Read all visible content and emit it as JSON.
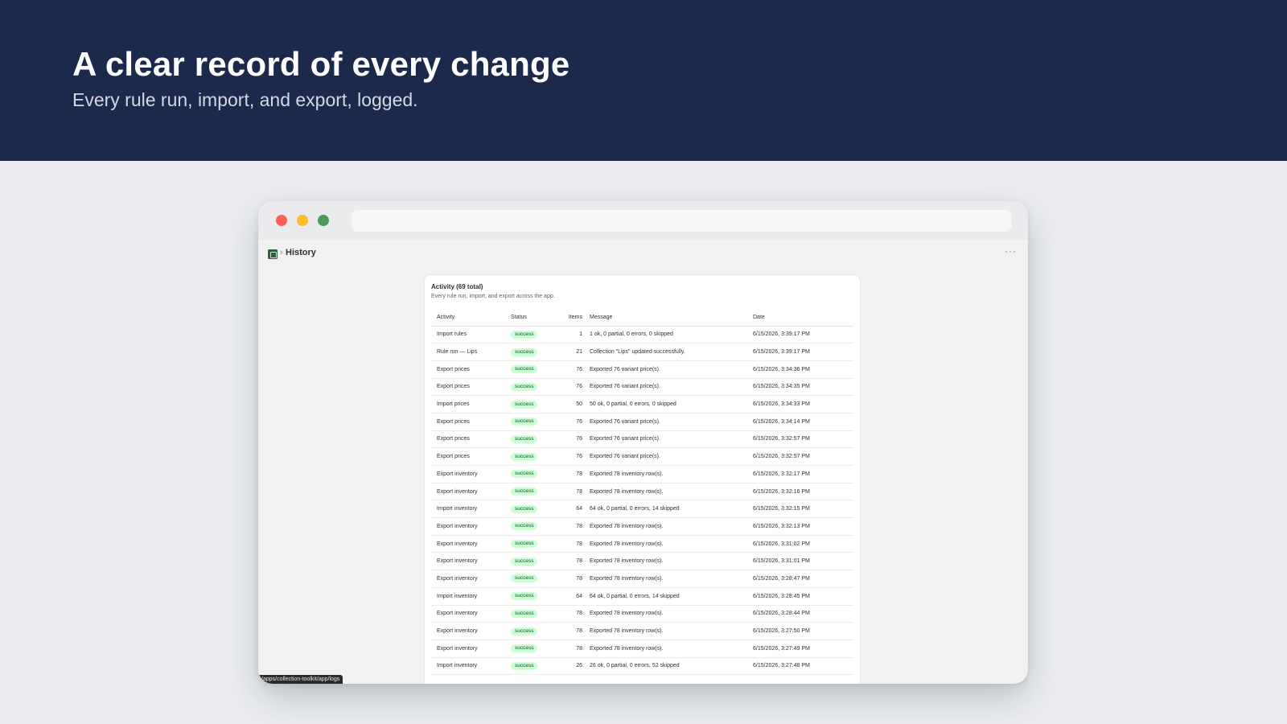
{
  "hero": {
    "title": "A clear record of every change",
    "subtitle": "Every rule run, import, and export, logged."
  },
  "app": {
    "breadcrumb_title": "History",
    "more_label": "···"
  },
  "card": {
    "title": "Activity (69 total)",
    "subtitle": "Every rule run, import, and export across the app.",
    "columns": [
      "Activity",
      "Status",
      "Items",
      "Message",
      "Date"
    ],
    "rows": [
      {
        "activity": "Import rules",
        "status": "success",
        "items": "1",
        "message": "1 ok, 0 partial, 0 errors, 0 skipped",
        "date": "6/15/2026, 3:39:17 PM"
      },
      {
        "activity": "Rule run — Lips",
        "status": "success",
        "items": "21",
        "message": "Collection \"Lips\" updated successfully.",
        "date": "6/15/2026, 3:39:17 PM"
      },
      {
        "activity": "Export prices",
        "status": "success",
        "items": "76",
        "message": "Exported 76 variant price(s).",
        "date": "6/15/2026, 3:34:36 PM"
      },
      {
        "activity": "Export prices",
        "status": "success",
        "items": "76",
        "message": "Exported 76 variant price(s).",
        "date": "6/15/2026, 3:34:35 PM"
      },
      {
        "activity": "Import prices",
        "status": "success",
        "items": "50",
        "message": "50 ok, 0 partial, 0 errors, 0 skipped",
        "date": "6/15/2026, 3:34:33 PM"
      },
      {
        "activity": "Export prices",
        "status": "success",
        "items": "76",
        "message": "Exported 76 variant price(s).",
        "date": "6/15/2026, 3:34:14 PM"
      },
      {
        "activity": "Export prices",
        "status": "success",
        "items": "76",
        "message": "Exported 76 variant price(s).",
        "date": "6/15/2026, 3:32:57 PM"
      },
      {
        "activity": "Export prices",
        "status": "success",
        "items": "76",
        "message": "Exported 76 variant price(s).",
        "date": "6/15/2026, 3:32:57 PM"
      },
      {
        "activity": "Export inventory",
        "status": "success",
        "items": "78",
        "message": "Exported 78 inventory row(s).",
        "date": "6/15/2026, 3:32:17 PM"
      },
      {
        "activity": "Export inventory",
        "status": "success",
        "items": "78",
        "message": "Exported 78 inventory row(s).",
        "date": "6/15/2026, 3:32:16 PM"
      },
      {
        "activity": "Import inventory",
        "status": "success",
        "items": "64",
        "message": "64 ok, 0 partial, 0 errors, 14 skipped",
        "date": "6/15/2026, 3:32:15 PM"
      },
      {
        "activity": "Export inventory",
        "status": "success",
        "items": "78",
        "message": "Exported 78 inventory row(s).",
        "date": "6/15/2026, 3:32:13 PM"
      },
      {
        "activity": "Export inventory",
        "status": "success",
        "items": "78",
        "message": "Exported 78 inventory row(s).",
        "date": "6/15/2026, 3:31:02 PM"
      },
      {
        "activity": "Export inventory",
        "status": "success",
        "items": "78",
        "message": "Exported 78 inventory row(s).",
        "date": "6/15/2026, 3:31:01 PM"
      },
      {
        "activity": "Export inventory",
        "status": "success",
        "items": "78",
        "message": "Exported 78 inventory row(s).",
        "date": "6/15/2026, 3:28:47 PM"
      },
      {
        "activity": "Import inventory",
        "status": "success",
        "items": "64",
        "message": "64 ok, 0 partial, 0 errors, 14 skipped",
        "date": "6/15/2026, 3:28:45 PM"
      },
      {
        "activity": "Export inventory",
        "status": "success",
        "items": "78",
        "message": "Exported 78 inventory row(s).",
        "date": "6/15/2026, 3:28:44 PM"
      },
      {
        "activity": "Export inventory",
        "status": "success",
        "items": "78",
        "message": "Exported 78 inventory row(s).",
        "date": "6/15/2026, 3:27:50 PM"
      },
      {
        "activity": "Export inventory",
        "status": "success",
        "items": "78",
        "message": "Exported 78 inventory row(s).",
        "date": "6/15/2026, 3:27:49 PM"
      },
      {
        "activity": "Import inventory",
        "status": "success",
        "items": "26",
        "message": "26 ok, 0 partial, 0 errors, 52 skipped",
        "date": "6/15/2026, 3:27:48 PM"
      }
    ]
  },
  "status_bar": {
    "url": "/apps/collection-toolkit/app/logs"
  },
  "colors": {
    "hero_bg": "#1b2a4a",
    "success_badge_bg": "#cdfed4",
    "success_badge_text": "#0c5132",
    "traffic_red": "#ff5f57",
    "traffic_yellow": "#febc2e",
    "traffic_green": "#4a9b5a"
  },
  "icons": {
    "app": "app-logo-icon",
    "breadcrumb_separator": "chevron-right-icon",
    "more": "more-horizontal-icon"
  }
}
